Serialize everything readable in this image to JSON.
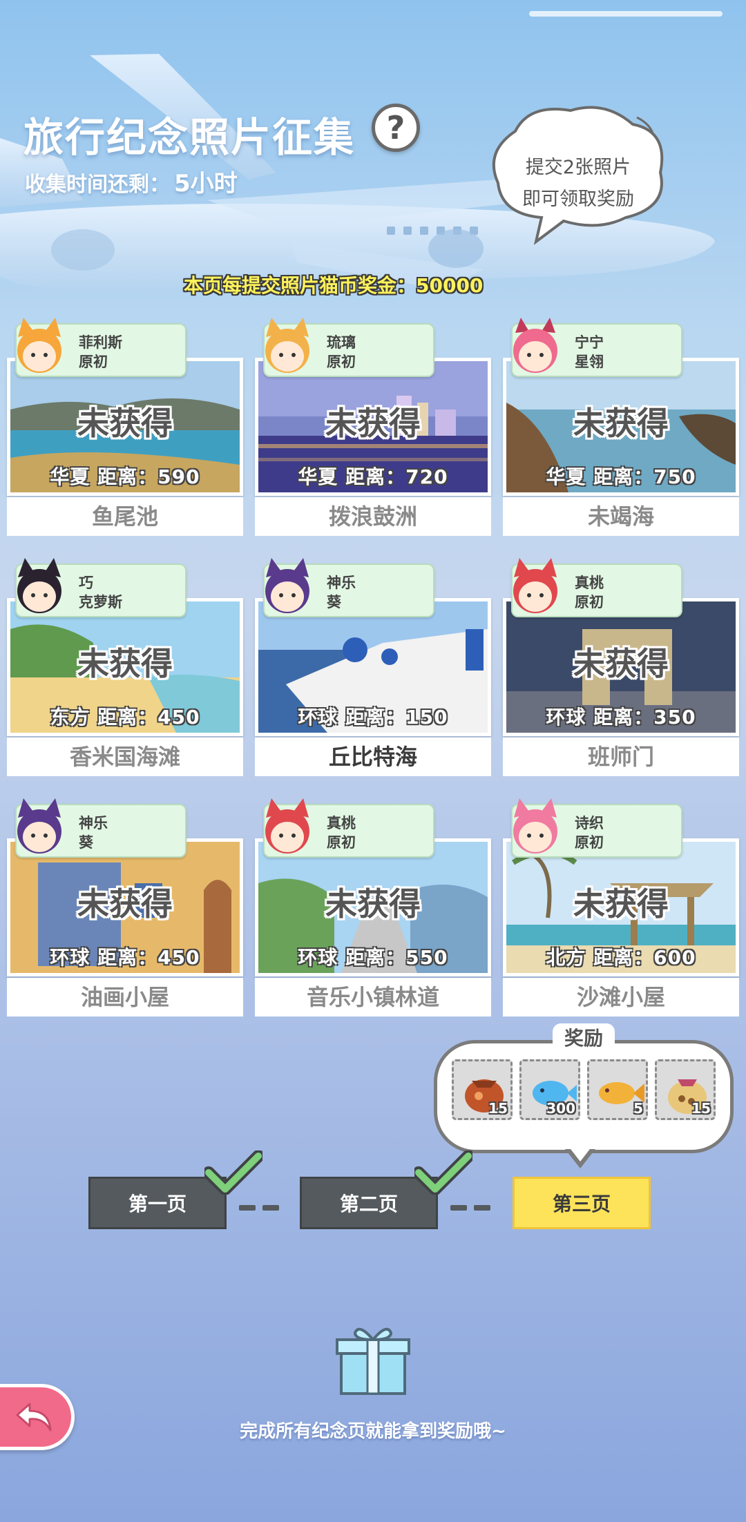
{
  "header": {
    "title": "旅行纪念照片征集",
    "help_label": "?",
    "remaining_label": "收集时间还剩：",
    "remaining_value": "5小时",
    "bubble_line1": "提交2张照片",
    "bubble_line2": "即可领取奖励",
    "bonus_text": "本页每提交照片猫币奖金：50000"
  },
  "cards": [
    {
      "character": "菲利斯",
      "outfit": "原初",
      "status": "未获得",
      "info": "华夏  距离：590",
      "name": "鱼尾池"
    },
    {
      "character": "琉璃",
      "outfit": "原初",
      "status": "未获得",
      "info": "华夏  距离：720",
      "name": "拨浪鼓洲"
    },
    {
      "character": "宁宁",
      "outfit": "星翎",
      "status": "未获得",
      "info": "华夏  距离：750",
      "name": "未竭海"
    },
    {
      "character": "巧",
      "outfit": "克萝斯",
      "status": "未获得",
      "info": "东方  距离：450",
      "name": "香米国海滩"
    },
    {
      "character": "神乐",
      "outfit": "葵",
      "status": "",
      "info": "环球  距离：150",
      "name": "丘比特海"
    },
    {
      "character": "真桃",
      "outfit": "原初",
      "status": "未获得",
      "info": "环球  距离：350",
      "name": "班师门"
    },
    {
      "character": "神乐",
      "outfit": "葵",
      "status": "未获得",
      "info": "环球  距离：450",
      "name": "油画小屋"
    },
    {
      "character": "真桃",
      "outfit": "原初",
      "status": "未获得",
      "info": "环球  距离：550",
      "name": "音乐小镇林道"
    },
    {
      "character": "诗织",
      "outfit": "原初",
      "status": "未获得",
      "info": "北方  距离：600",
      "name": "沙滩小屋"
    }
  ],
  "rewards": {
    "title": "奖励",
    "items": [
      {
        "icon": "fish-bag-icon",
        "qty": "15"
      },
      {
        "icon": "blue-fish-icon",
        "qty": "300"
      },
      {
        "icon": "taiyaki-icon",
        "qty": "5"
      },
      {
        "icon": "treat-sack-icon",
        "qty": "15"
      }
    ]
  },
  "pages": [
    {
      "label": "第一页",
      "done": true
    },
    {
      "label": "第二页",
      "done": true
    },
    {
      "label": "第三页",
      "done": false
    }
  ],
  "footer": {
    "text": "完成所有纪念页就能拿到奖励哦~"
  },
  "colors": {
    "accent_yellow": "#fde35a",
    "tag_green": "#e2f7e4",
    "back_pink": "#f26a8a",
    "check_green": "#7ed07a"
  }
}
